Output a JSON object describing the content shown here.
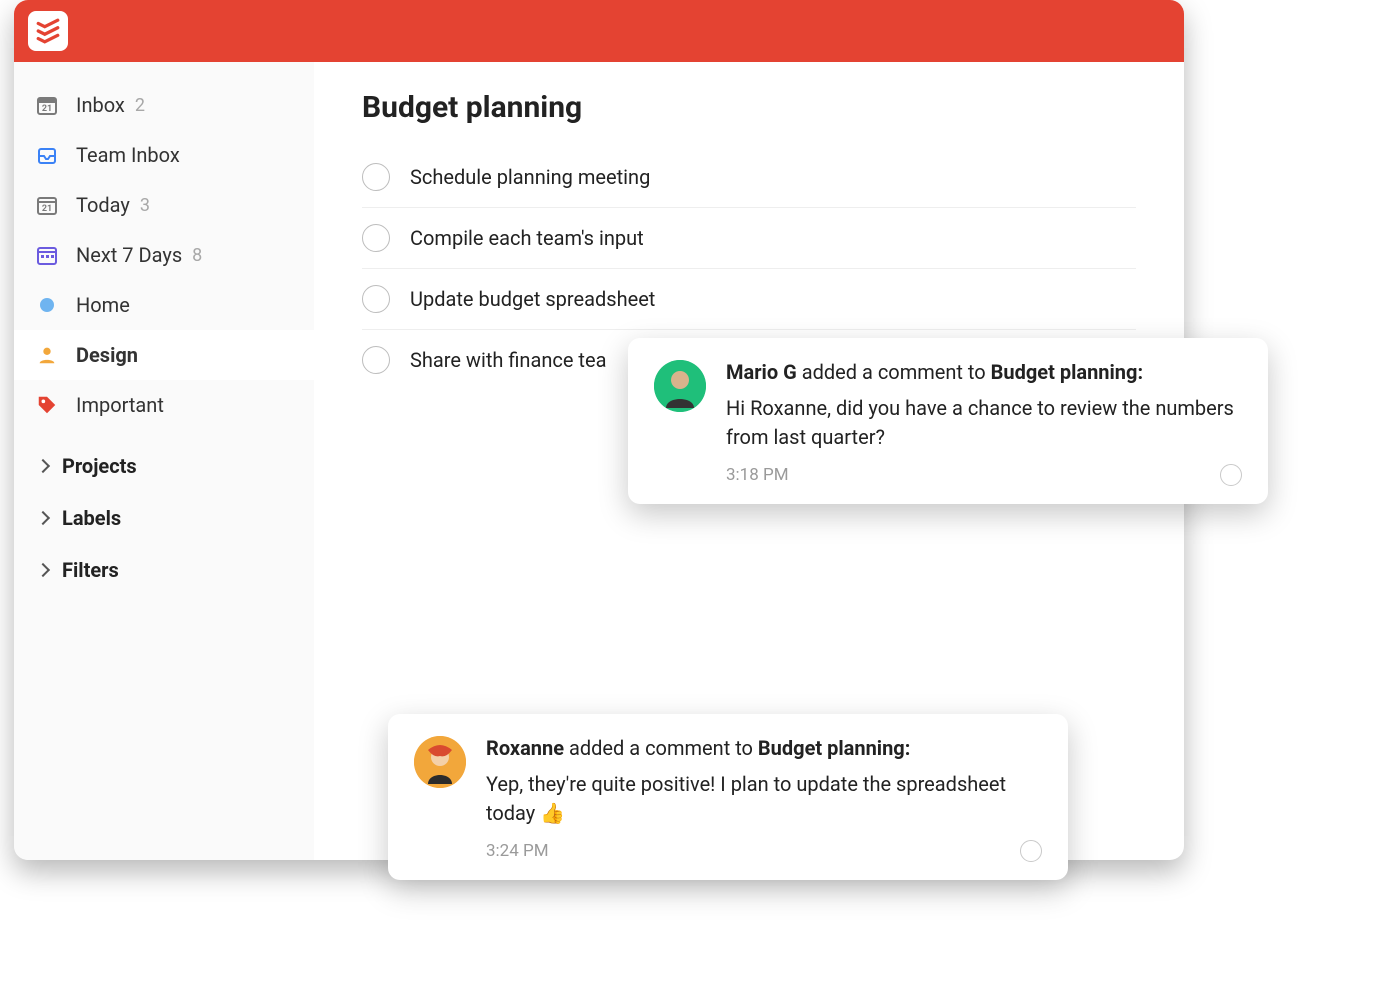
{
  "sidebar": {
    "items": [
      {
        "label": "Inbox",
        "count": "2"
      },
      {
        "label": "Team Inbox"
      },
      {
        "label": "Today",
        "count": "3"
      },
      {
        "label": "Next 7 Days",
        "count": "8"
      },
      {
        "label": "Home"
      },
      {
        "label": "Design"
      },
      {
        "label": "Important"
      }
    ],
    "sections": [
      {
        "label": "Projects"
      },
      {
        "label": "Labels"
      },
      {
        "label": "Filters"
      }
    ]
  },
  "main": {
    "project_title": "Budget planning",
    "tasks": [
      "Schedule planning meeting",
      "Compile each team's input",
      "Update budget spreadsheet",
      "Share with finance tea"
    ]
  },
  "notifications": [
    {
      "author": "Mario G",
      "action": "added a comment to",
      "target": "Budget planning:",
      "text": "Hi Roxanne, did you have a chance to review the numbers from last quarter?",
      "time": "3:18 PM"
    },
    {
      "author": "Roxanne",
      "action": "added a comment to",
      "target": "Budget planning:",
      "text": "Yep, they're quite positive! I plan to update the spreadsheet today 👍",
      "time": "3:24 PM"
    }
  ]
}
